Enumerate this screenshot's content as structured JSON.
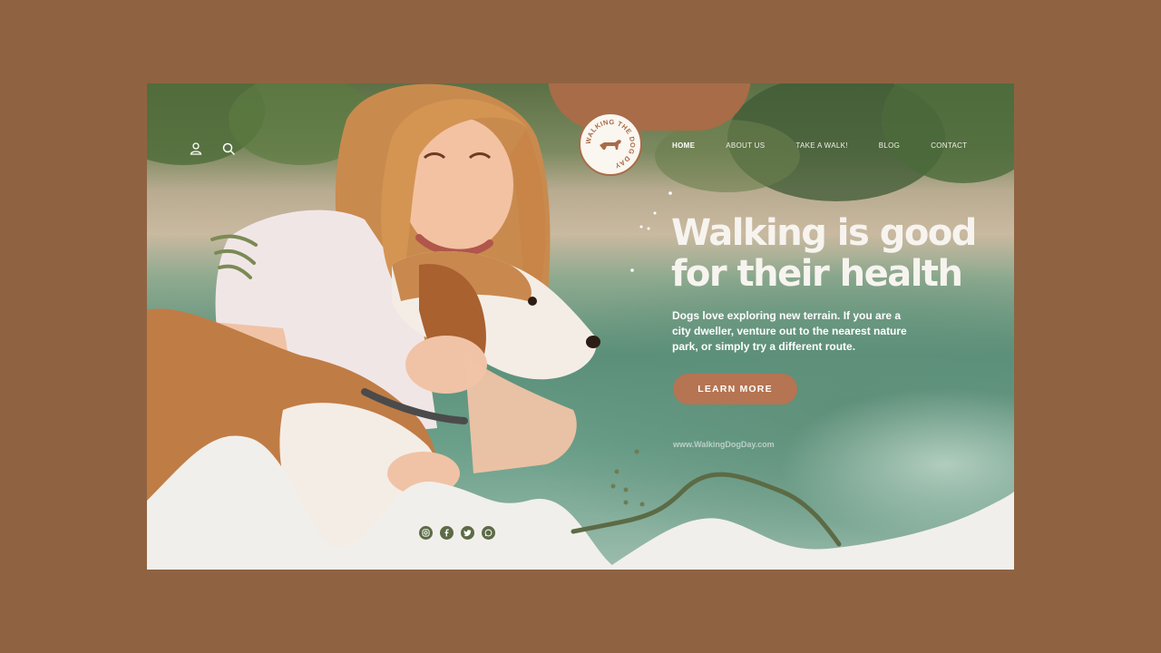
{
  "brand": {
    "logo_text": "WALKING THE DOG DAY"
  },
  "header": {
    "nav": [
      {
        "label": "HOME",
        "active": true
      },
      {
        "label": "ABOUT US",
        "active": false
      },
      {
        "label": "TAKE A WALK!",
        "active": false
      },
      {
        "label": "BLOG",
        "active": false
      },
      {
        "label": "CONTACT",
        "active": false
      }
    ],
    "icons": [
      "user-icon",
      "search-icon"
    ]
  },
  "hero": {
    "title_line1": "Walking is good",
    "title_line2": "for their health",
    "description": "Dogs love exploring new terrain. If you are a city dweller, venture out to the nearest nature park, or simply try a different route.",
    "cta_label": "LEARN MORE",
    "watermark": "www.WalkingDogDay.com"
  },
  "social": [
    "instagram-icon",
    "facebook-icon",
    "twitter-icon",
    "whatsapp-icon"
  ],
  "colors": {
    "page_background": "#8f6342",
    "accent_brown": "#b57452",
    "olive": "#5c6b45",
    "cream": "#f1efeb"
  }
}
